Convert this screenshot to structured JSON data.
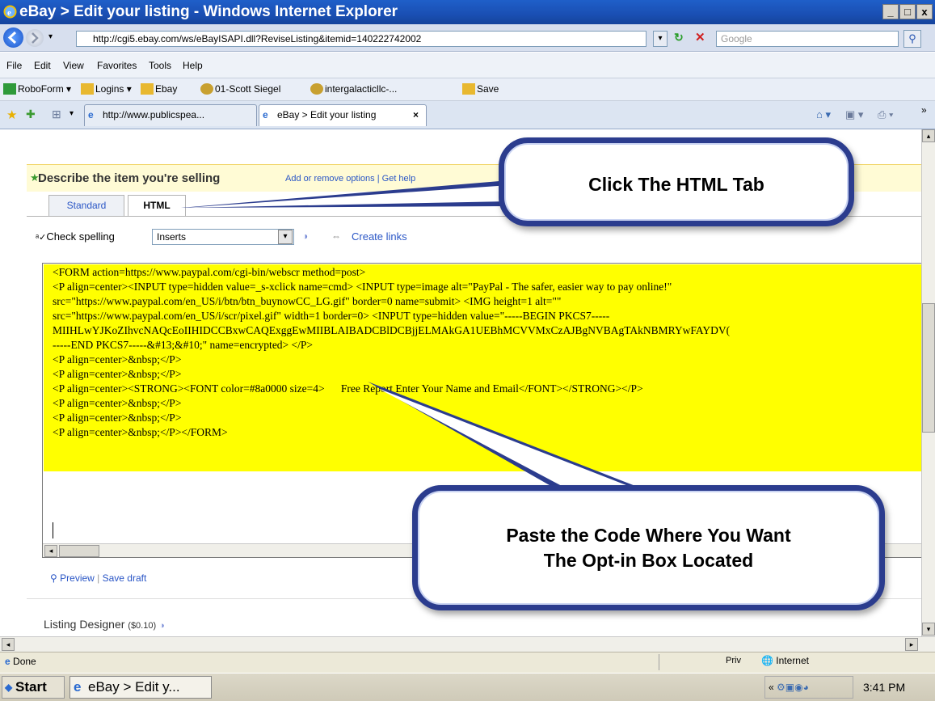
{
  "window": {
    "title": "eBay > Edit your listing - Windows Internet Explorer",
    "controls": [
      "_",
      "□",
      "x"
    ]
  },
  "address": {
    "url": "http://cgi5.ebay.com/ws/eBayISAPI.dll?ReviseListing&itemid=140222742002",
    "search_placeholder": "Google"
  },
  "menu": {
    "items": [
      "File",
      "Edit",
      "View",
      "Favorites",
      "Tools",
      "Help"
    ]
  },
  "links": {
    "items": [
      "RoboForm ▾",
      "Logins ▾",
      "Ebay",
      "01-Scott Siegel",
      "intergalacticllc-...",
      "Save"
    ]
  },
  "tabs": {
    "items": [
      "http://www.publicspea...",
      "eBay > Edit your listing"
    ]
  },
  "page": {
    "section_title": "Describe the item you're selling",
    "section_links": "Add or remove options | Get help",
    "editor_tabs": [
      "Standard",
      "HTML"
    ],
    "check_spelling": "Check spelling",
    "inserts": "Inserts",
    "create_links": "Create links",
    "code_lines": [
      "<FORM action=https://www.paypal.com/cgi-bin/webscr method=post>",
      "<P align=center><INPUT type=hidden value=_s-xclick name=cmd> <INPUT type=image alt=\"PayPal - The safer, easier way to pay online!\"",
      "src=\"https://www.paypal.com/en_US/i/btn/btn_buynowCC_LG.gif\" border=0 name=submit> <IMG height=1 alt=\"\"",
      "src=\"https://www.paypal.com/en_US/i/scr/pixel.gif\" width=1 border=0> <INPUT type=hidden value=\"-----BEGIN PKCS7-----",
      "MIIHLwYJKoZIhvcNAQcEoIIHIDCCBxwCAQExggEwMIIBLAIBADCBlDCBjjELMAkGA1UEBhMCVVMxCzAJBgNVBAgTAkNBMRYwFAYDV(",
      "-----END PKCS7-----&#13;&#10;\" name=encrypted> </P>",
      "<P align=center>&nbsp;</P>",
      "<P align=center>&nbsp;</P>",
      "<P align=center><STRONG><FONT color=#8a0000 size=4>      Free Report Enter Your Name and Email</FONT></STRONG></P>",
      "<P align=center>&nbsp;</P>",
      "<P align=center>&nbsp;</P>",
      "<P align=center>&nbsp;</P></FORM>"
    ],
    "preview": "Preview",
    "save_draft": "Save draft",
    "listing_designer": "Listing Designer",
    "listing_designer_price": "($0.10)"
  },
  "callouts": {
    "html_tab": "Click The HTML Tab",
    "paste_line1": "Paste the Code Where You Want",
    "paste_line2": "The Opt-in Box Located"
  },
  "status": {
    "left": "Done",
    "priv": "Priv",
    "zone": "Internet"
  },
  "taskbar": {
    "start": "Start",
    "task": "eBay > Edit y...",
    "clock": "3:41 PM"
  },
  "colors": {
    "title_bar": "#1a4fb3",
    "code_highlight": "#ffff00",
    "callout_border": "#2b3c8e",
    "link": "#2a56c6"
  }
}
